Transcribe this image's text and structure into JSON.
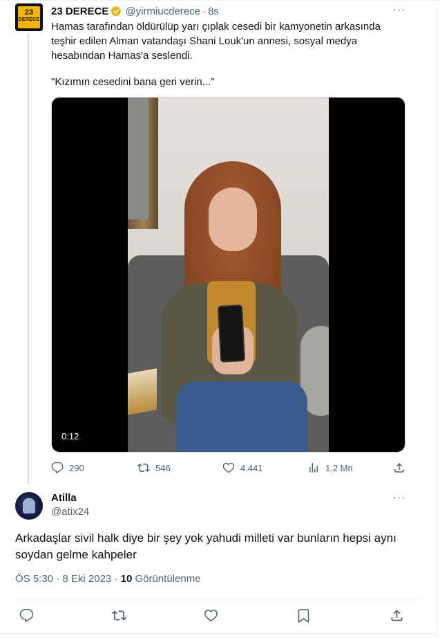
{
  "parent_tweet": {
    "avatar_text_top": "23",
    "avatar_text_bottom": "DERECE",
    "display_name": "23 DERECE",
    "handle": "@yirmiucderece",
    "separator": "·",
    "time": "8s",
    "text": "Hamas tarafından öldürülüp yarı çıplak cesedi bir kamyonetin arkasında teşhir edilen Alman vatandaşı Shani Louk'un annesi, sosyal medya hesabından Hamas'a seslendi.",
    "quote": "\"Kızımın cesedini bana geri verin...\"",
    "video_duration": "0:12",
    "metrics": {
      "replies": "290",
      "retweets": "546",
      "likes": "4.441",
      "views": "1,2 Mn"
    }
  },
  "reply_tweet": {
    "display_name": "Atilla",
    "handle": "@atix24",
    "text": "Arkadaşlar sivil halk diye bir şey yok yahudi milleti var bunların hepsi aynı soydan gelme kahpeler",
    "time": "ÖS 5:30",
    "separator": " · ",
    "date": "8 Eki 2023",
    "separator2": " · ",
    "views_count": "10",
    "views_label": "Görüntülenme"
  },
  "more_glyph": "···",
  "colors": {
    "text_primary": "#0f1419",
    "text_secondary": "#536471",
    "border": "#cfd9de",
    "verified": "#e2b719",
    "avatar_accent": "#f4b400"
  },
  "icons": [
    "verified-badge-icon",
    "reply-icon",
    "retweet-icon",
    "like-icon",
    "views-icon",
    "share-icon",
    "bookmark-icon",
    "more-icon"
  ]
}
